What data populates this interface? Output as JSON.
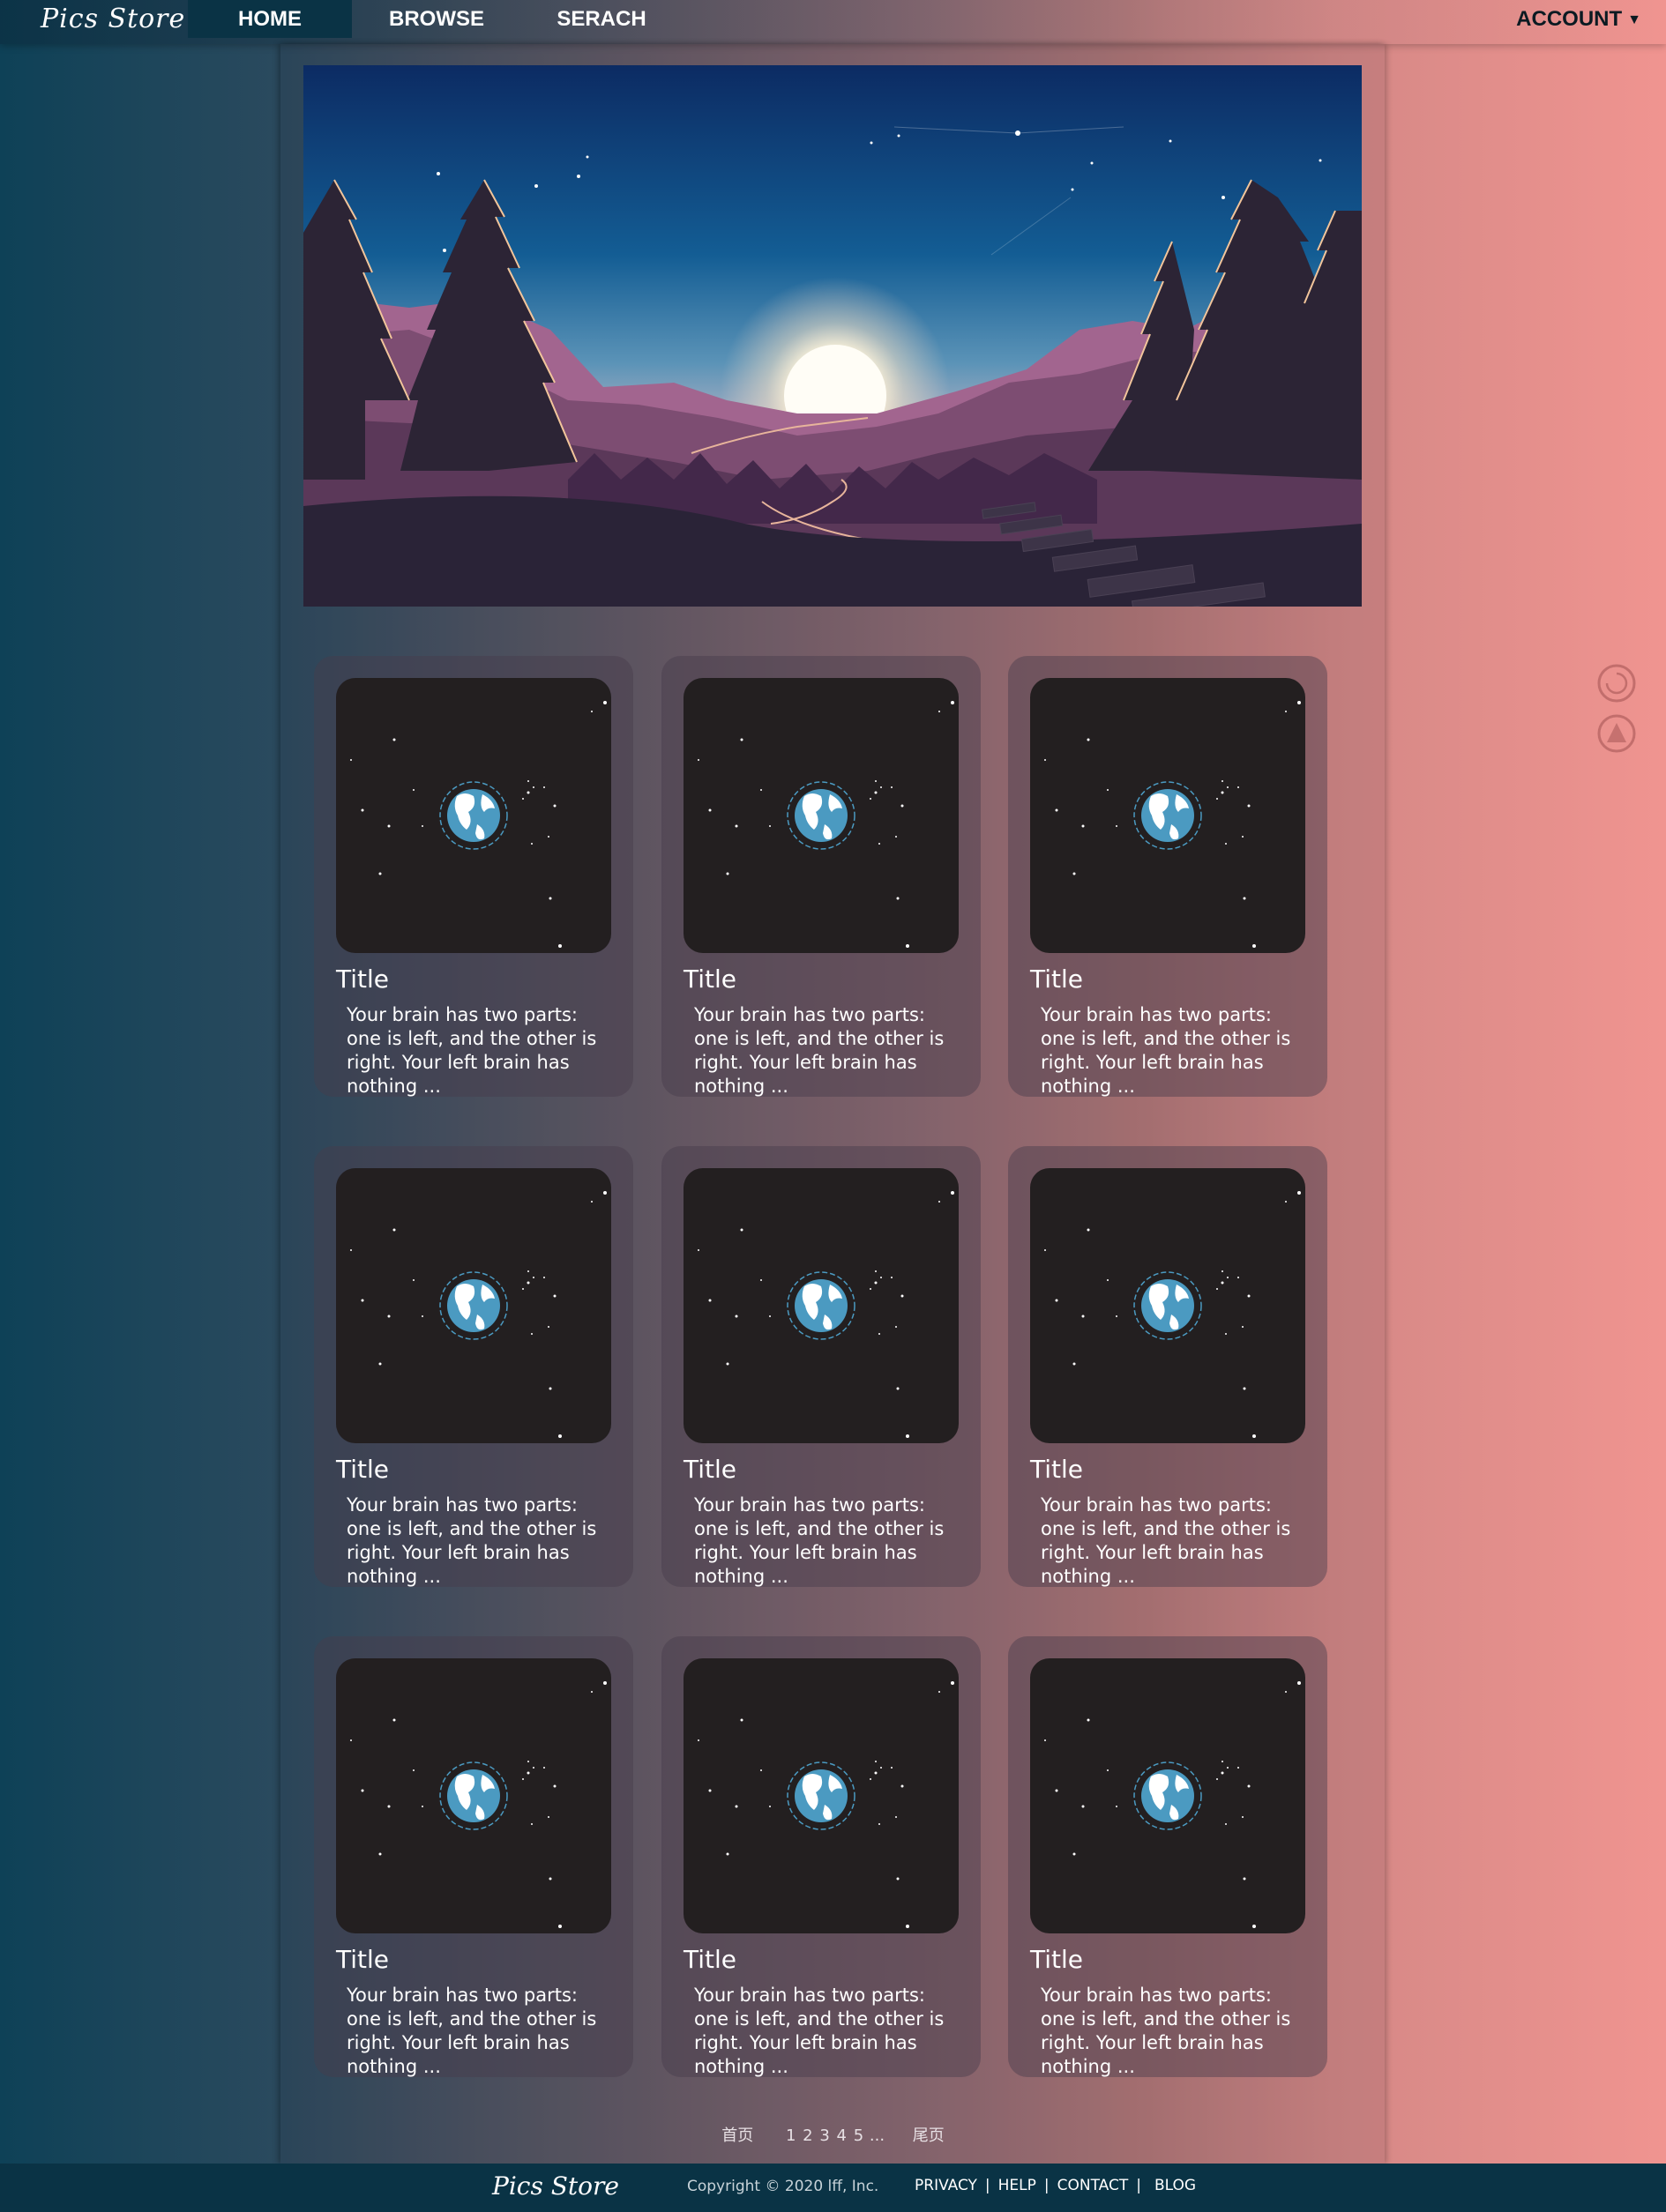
{
  "nav": {
    "logo": "Pics Store",
    "items": [
      {
        "label": "HOME",
        "active": true
      },
      {
        "label": "BROWSE",
        "active": false
      },
      {
        "label": "SERACH",
        "active": false
      }
    ],
    "account_label": "ACCOUNT",
    "account_caret": "▼"
  },
  "cards": [
    {
      "title": "Title",
      "desc": "Your brain has two parts: one is left, and the other is right. Your left brain has nothing ..."
    },
    {
      "title": "Title",
      "desc": "Your brain has two parts: one is left, and the other is right. Your left brain has nothing ..."
    },
    {
      "title": "Title",
      "desc": "Your brain has two parts: one is left, and the other is right. Your left brain has nothing ..."
    },
    {
      "title": "Title",
      "desc": "Your brain has two parts: one is left, and the other is right. Your left brain has nothing ..."
    },
    {
      "title": "Title",
      "desc": "Your brain has two parts: one is left, and the other is right. Your left brain has nothing ..."
    },
    {
      "title": "Title",
      "desc": "Your brain has two parts: one is left, and the other is right. Your left brain has nothing ..."
    },
    {
      "title": "Title",
      "desc": "Your brain has two parts: one is left, and the other is right. Your left brain has nothing ..."
    },
    {
      "title": "Title",
      "desc": "Your brain has two parts: one is left, and the other is right. Your left brain has nothing ..."
    },
    {
      "title": "Title",
      "desc": "Your brain has two parts: one is left, and the other is right. Your left brain has nothing ..."
    }
  ],
  "side_icons": [
    "refresh-icon",
    "scroll-top-icon"
  ],
  "pagination": {
    "first": "首页",
    "pages": [
      "1",
      "2",
      "3",
      "4",
      "5"
    ],
    "ellipsis": "...",
    "last": "尾页"
  },
  "footer": {
    "logo": "Pics Store",
    "copyright": "Copyright © 2020 lff, Inc.",
    "links": [
      "PRIVACY",
      "HELP",
      "CONTACT",
      "BLOG"
    ]
  },
  "colors": {
    "nav_active_bg": "#0a3345",
    "footer_bg": "#0a3345",
    "card_image_bg": "#231f20",
    "globe_blue": "#4b9ac1"
  }
}
